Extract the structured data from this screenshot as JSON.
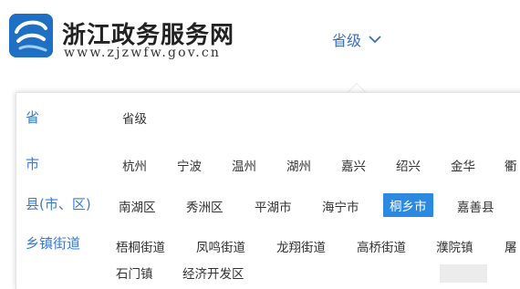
{
  "header": {
    "site_title": "浙江政务服务网",
    "site_url": "www.zjzwfw.gov.cn",
    "level_label": "省级",
    "logo_icon": "zhejiang-logo-icon",
    "brand_color": "#1f6fc4"
  },
  "panel": {
    "rows": [
      {
        "label": "省",
        "options": [
          "省级"
        ]
      },
      {
        "label": "市",
        "options": [
          "杭州",
          "宁波",
          "温州",
          "湖州",
          "嘉兴",
          "绍兴",
          "金华",
          "衢"
        ]
      },
      {
        "label": "县(市、区)",
        "options": [
          "南湖区",
          "秀洲区",
          "平湖市",
          "海宁市",
          "桐乡市",
          "嘉善县"
        ],
        "selected": "桐乡市"
      },
      {
        "label": "乡镇街道",
        "options": [
          "梧桐街道",
          "凤鸣街道",
          "龙翔街道",
          "高桥街道",
          "濮院镇",
          "屠",
          "石门镇",
          "经济开发区"
        ]
      }
    ],
    "accent_color": "#3a7bd5",
    "selected_color": "#2b8ae0"
  }
}
